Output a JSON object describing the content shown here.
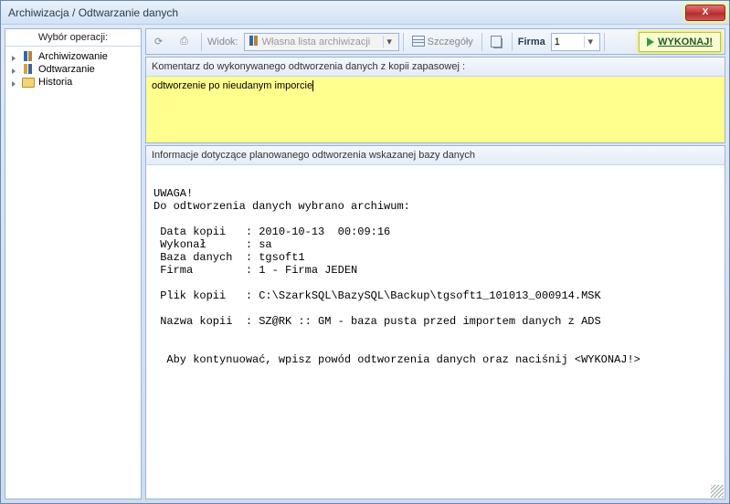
{
  "titlebar": {
    "title": "Archiwizacja / Odtwarzanie danych",
    "close_symbol": "X"
  },
  "sidebar": {
    "header": "Wybór operacji:",
    "items": [
      {
        "label": "Archiwizowanie"
      },
      {
        "label": "Odtwarzanie"
      },
      {
        "label": "Historia"
      }
    ]
  },
  "toolbar": {
    "refresh_icon": "⟳",
    "print_icon": "⎙",
    "widok_label": "Widok:",
    "widok_value": "Własna lista archiwizacji",
    "szczegoly_label": "Szczegóły",
    "firma_label": "Firma",
    "firma_value": "1",
    "wykonaj_label": "WYKONAJ!"
  },
  "comment": {
    "header": "Komentarz do wykonywanego odtworzenia danych z kopii zapasowej :",
    "value": "odtworzenie po nieudanym imporcie"
  },
  "info": {
    "header": "Informacje dotyczące planowanego odtworzenia wskazanej bazy danych",
    "body": "\nUWAGA!\nDo odtworzenia danych wybrano archiwum:\n\n Data kopii   : 2010-10-13  00:09:16\n Wykonał      : sa\n Baza danych  : tgsoft1\n Firma        : 1 - Firma JEDEN\n\n Plik kopii   : C:\\SzarkSQL\\BazySQL\\Backup\\tgsoft1_101013_000914.MSK\n\n Nazwa kopii  : SZ@RK :: GM - baza pusta przed importem danych z ADS\n\n\n  Aby kontynuować, wpisz powód odtworzenia danych oraz naciśnij <WYKONAJ!>\n"
  },
  "colors": {
    "highlight": "#ffff8e",
    "accent": "#3766a6"
  }
}
